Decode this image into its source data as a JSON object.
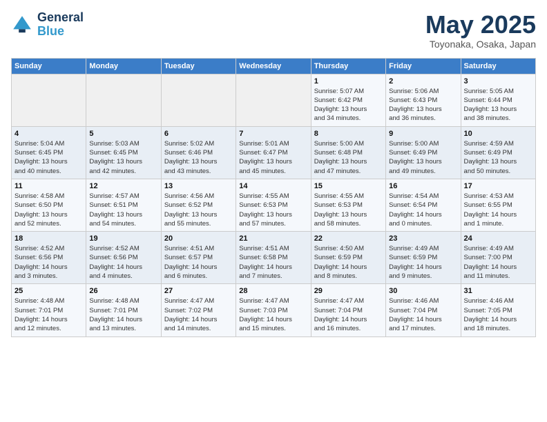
{
  "header": {
    "logo_line1": "General",
    "logo_line2": "Blue",
    "month": "May 2025",
    "location": "Toyonaka, Osaka, Japan"
  },
  "weekdays": [
    "Sunday",
    "Monday",
    "Tuesday",
    "Wednesday",
    "Thursday",
    "Friday",
    "Saturday"
  ],
  "weeks": [
    [
      {
        "day": "",
        "info": ""
      },
      {
        "day": "",
        "info": ""
      },
      {
        "day": "",
        "info": ""
      },
      {
        "day": "",
        "info": ""
      },
      {
        "day": "1",
        "info": "Sunrise: 5:07 AM\nSunset: 6:42 PM\nDaylight: 13 hours\nand 34 minutes."
      },
      {
        "day": "2",
        "info": "Sunrise: 5:06 AM\nSunset: 6:43 PM\nDaylight: 13 hours\nand 36 minutes."
      },
      {
        "day": "3",
        "info": "Sunrise: 5:05 AM\nSunset: 6:44 PM\nDaylight: 13 hours\nand 38 minutes."
      }
    ],
    [
      {
        "day": "4",
        "info": "Sunrise: 5:04 AM\nSunset: 6:45 PM\nDaylight: 13 hours\nand 40 minutes."
      },
      {
        "day": "5",
        "info": "Sunrise: 5:03 AM\nSunset: 6:45 PM\nDaylight: 13 hours\nand 42 minutes."
      },
      {
        "day": "6",
        "info": "Sunrise: 5:02 AM\nSunset: 6:46 PM\nDaylight: 13 hours\nand 43 minutes."
      },
      {
        "day": "7",
        "info": "Sunrise: 5:01 AM\nSunset: 6:47 PM\nDaylight: 13 hours\nand 45 minutes."
      },
      {
        "day": "8",
        "info": "Sunrise: 5:00 AM\nSunset: 6:48 PM\nDaylight: 13 hours\nand 47 minutes."
      },
      {
        "day": "9",
        "info": "Sunrise: 5:00 AM\nSunset: 6:49 PM\nDaylight: 13 hours\nand 49 minutes."
      },
      {
        "day": "10",
        "info": "Sunrise: 4:59 AM\nSunset: 6:49 PM\nDaylight: 13 hours\nand 50 minutes."
      }
    ],
    [
      {
        "day": "11",
        "info": "Sunrise: 4:58 AM\nSunset: 6:50 PM\nDaylight: 13 hours\nand 52 minutes."
      },
      {
        "day": "12",
        "info": "Sunrise: 4:57 AM\nSunset: 6:51 PM\nDaylight: 13 hours\nand 54 minutes."
      },
      {
        "day": "13",
        "info": "Sunrise: 4:56 AM\nSunset: 6:52 PM\nDaylight: 13 hours\nand 55 minutes."
      },
      {
        "day": "14",
        "info": "Sunrise: 4:55 AM\nSunset: 6:53 PM\nDaylight: 13 hours\nand 57 minutes."
      },
      {
        "day": "15",
        "info": "Sunrise: 4:55 AM\nSunset: 6:53 PM\nDaylight: 13 hours\nand 58 minutes."
      },
      {
        "day": "16",
        "info": "Sunrise: 4:54 AM\nSunset: 6:54 PM\nDaylight: 14 hours\nand 0 minutes."
      },
      {
        "day": "17",
        "info": "Sunrise: 4:53 AM\nSunset: 6:55 PM\nDaylight: 14 hours\nand 1 minute."
      }
    ],
    [
      {
        "day": "18",
        "info": "Sunrise: 4:52 AM\nSunset: 6:56 PM\nDaylight: 14 hours\nand 3 minutes."
      },
      {
        "day": "19",
        "info": "Sunrise: 4:52 AM\nSunset: 6:56 PM\nDaylight: 14 hours\nand 4 minutes."
      },
      {
        "day": "20",
        "info": "Sunrise: 4:51 AM\nSunset: 6:57 PM\nDaylight: 14 hours\nand 6 minutes."
      },
      {
        "day": "21",
        "info": "Sunrise: 4:51 AM\nSunset: 6:58 PM\nDaylight: 14 hours\nand 7 minutes."
      },
      {
        "day": "22",
        "info": "Sunrise: 4:50 AM\nSunset: 6:59 PM\nDaylight: 14 hours\nand 8 minutes."
      },
      {
        "day": "23",
        "info": "Sunrise: 4:49 AM\nSunset: 6:59 PM\nDaylight: 14 hours\nand 9 minutes."
      },
      {
        "day": "24",
        "info": "Sunrise: 4:49 AM\nSunset: 7:00 PM\nDaylight: 14 hours\nand 11 minutes."
      }
    ],
    [
      {
        "day": "25",
        "info": "Sunrise: 4:48 AM\nSunset: 7:01 PM\nDaylight: 14 hours\nand 12 minutes."
      },
      {
        "day": "26",
        "info": "Sunrise: 4:48 AM\nSunset: 7:01 PM\nDaylight: 14 hours\nand 13 minutes."
      },
      {
        "day": "27",
        "info": "Sunrise: 4:47 AM\nSunset: 7:02 PM\nDaylight: 14 hours\nand 14 minutes."
      },
      {
        "day": "28",
        "info": "Sunrise: 4:47 AM\nSunset: 7:03 PM\nDaylight: 14 hours\nand 15 minutes."
      },
      {
        "day": "29",
        "info": "Sunrise: 4:47 AM\nSunset: 7:04 PM\nDaylight: 14 hours\nand 16 minutes."
      },
      {
        "day": "30",
        "info": "Sunrise: 4:46 AM\nSunset: 7:04 PM\nDaylight: 14 hours\nand 17 minutes."
      },
      {
        "day": "31",
        "info": "Sunrise: 4:46 AM\nSunset: 7:05 PM\nDaylight: 14 hours\nand 18 minutes."
      }
    ]
  ]
}
